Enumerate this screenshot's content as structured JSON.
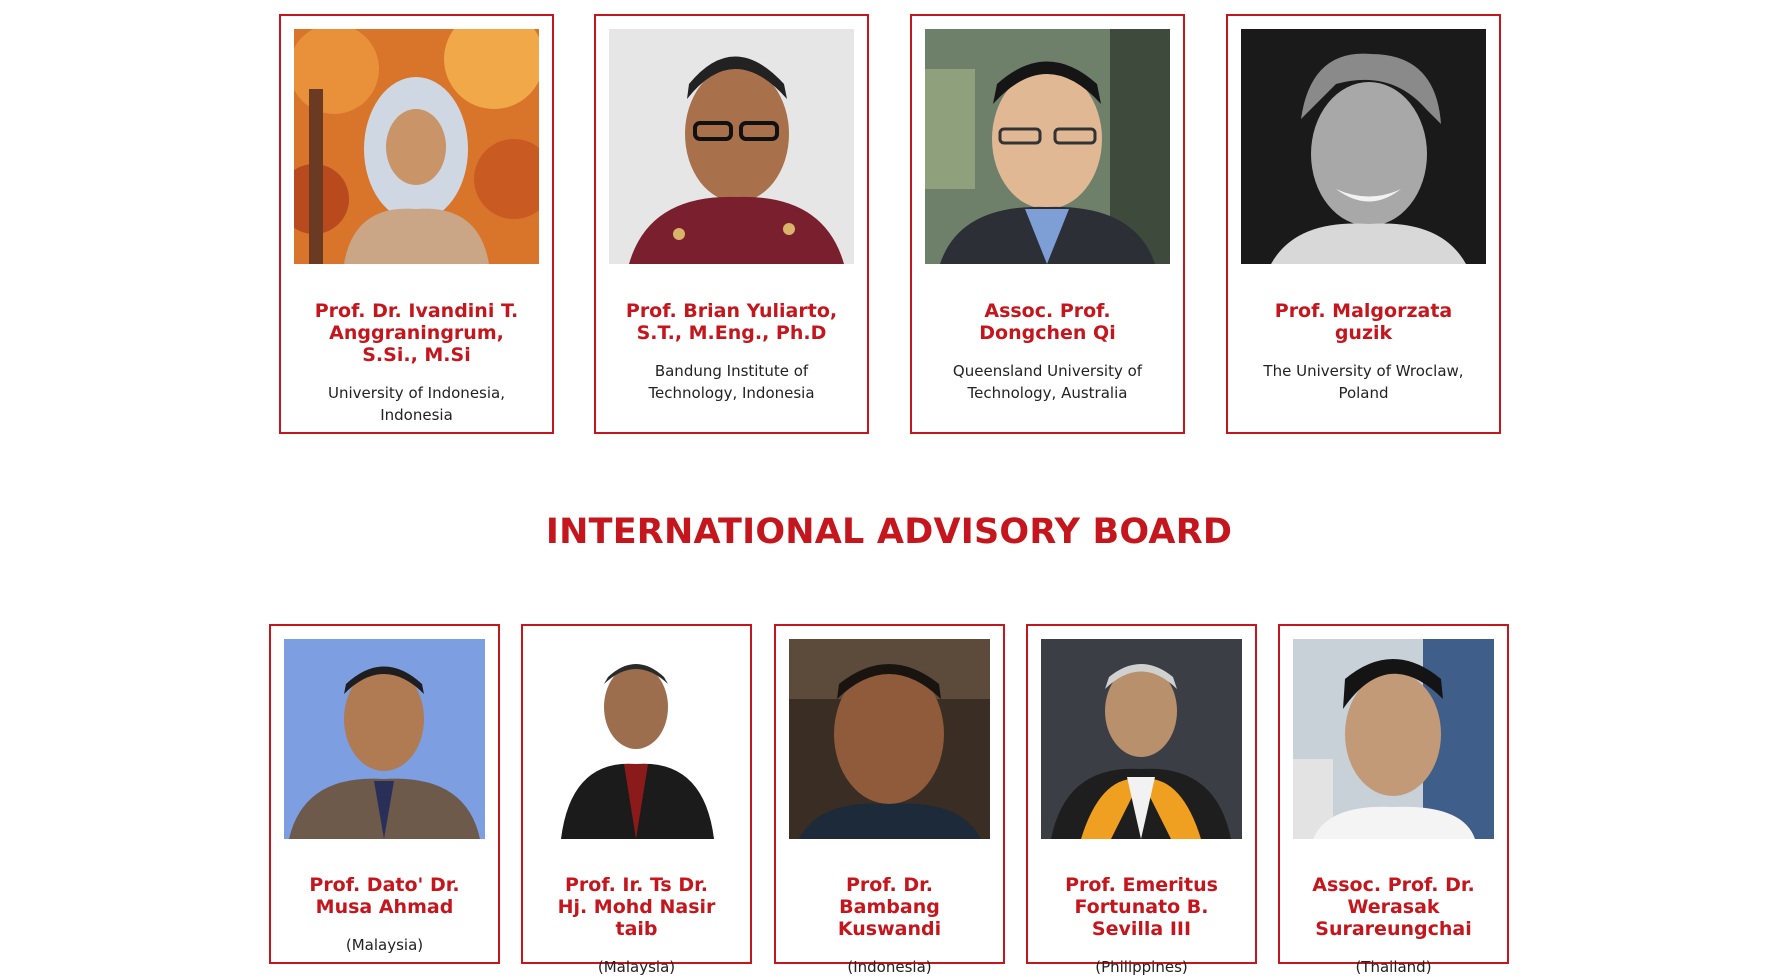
{
  "committee": [
    {
      "name_lines": [
        "Prof. Dr. Ivandini T.",
        "Anggraningrum,",
        "S.Si., M.Si"
      ],
      "aff_lines": [
        "University of Indonesia,",
        "Indonesia"
      ],
      "photo": "autumn-leaves-portrait-hijab"
    },
    {
      "name_lines": [
        "Prof. Brian Yuliarto,",
        "S.T., M.Eng., Ph.D"
      ],
      "aff_lines": [
        "Bandung Institute of",
        "Technology, Indonesia"
      ],
      "photo": "portrait-batik-glasses"
    },
    {
      "name_lines": [
        "Assoc. Prof.",
        "Dongchen Qi"
      ],
      "aff_lines": [
        "Queensland University of",
        "Technology, Australia"
      ],
      "photo": "portrait-suit-glasses"
    },
    {
      "name_lines": [
        "Prof. Malgorzata",
        "guzik"
      ],
      "aff_lines": [
        "The University of Wroclaw,",
        "Poland"
      ],
      "photo": "portrait-bw-smiling"
    }
  ],
  "advisory_heading": "INTERNATIONAL ADVISORY BOARD",
  "advisory": [
    {
      "name_lines": [
        "Prof. Dato' Dr.",
        "Musa Ahmad"
      ],
      "aff_lines": [
        "(Malaysia)"
      ],
      "photo": "portrait-blue-bg-suit"
    },
    {
      "name_lines": [
        "Prof. Ir. Ts Dr.",
        "Hj. Mohd Nasir",
        "taib"
      ],
      "aff_lines": [
        "(Malaysia)"
      ],
      "photo": "portrait-white-bg-suit"
    },
    {
      "name_lines": [
        "Prof. Dr.",
        "Bambang",
        "Kuswandi"
      ],
      "aff_lines": [
        "(Indonesia)"
      ],
      "photo": "portrait-dark-bg"
    },
    {
      "name_lines": [
        "Prof. Emeritus",
        "Fortunato B.",
        "Sevilla III"
      ],
      "aff_lines": [
        "(Philippines)"
      ],
      "photo": "portrait-academic-gown"
    },
    {
      "name_lines": [
        "Assoc. Prof. Dr.",
        "Werasak",
        "Surareungchai"
      ],
      "aff_lines": [
        "(Thailand)"
      ],
      "photo": "portrait-office-bg"
    }
  ],
  "colors": {
    "accent": "#c4161c",
    "text": "#222222"
  }
}
